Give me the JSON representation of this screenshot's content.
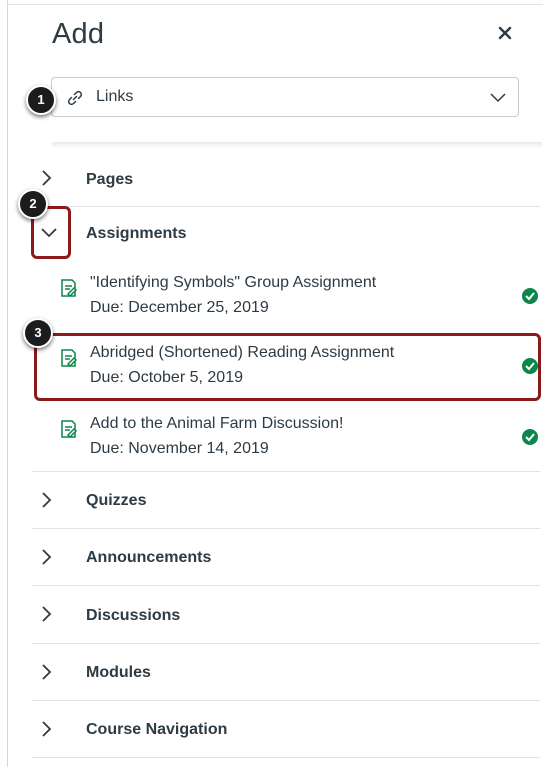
{
  "panel": {
    "title": "Add"
  },
  "link_type": {
    "selected": "Links"
  },
  "callouts": [
    "1",
    "2",
    "3"
  ],
  "sections": {
    "pages": "Pages",
    "assignments": "Assignments",
    "quizzes": "Quizzes",
    "announcements": "Announcements",
    "discussions": "Discussions",
    "modules": "Modules",
    "course_navigation": "Course Navigation"
  },
  "assignments": [
    {
      "title": "\"Identifying Symbols\" Group Assignment",
      "due": "Due: December 25, 2019",
      "published": true
    },
    {
      "title": "Abridged (Shortened) Reading Assignment",
      "due": "Due: October 5, 2019",
      "published": true
    },
    {
      "title": "Add to the Animal Farm Discussion!",
      "due": "Due: November 14, 2019",
      "published": true
    }
  ],
  "colors": {
    "highlight": "#8b1a1a",
    "published_green": "#0b874b",
    "assignment_icon": "#0b874b",
    "text": "#2d3b45"
  },
  "icons": {
    "close": "close-icon",
    "link": "link-icon",
    "dropdown": "chevron-down-icon",
    "collapsed": "chevron-right-icon",
    "expanded": "chevron-down-icon",
    "assignment": "assignment-icon",
    "published": "check-circle-icon"
  }
}
